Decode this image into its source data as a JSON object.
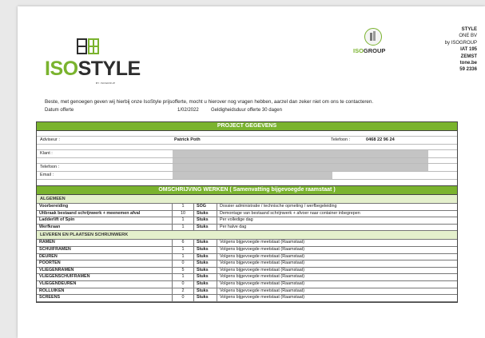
{
  "logo": {
    "brand_iso": "ISO",
    "brand_style": "STYLE",
    "tagline": "BY ISOGROUP"
  },
  "partner_logo": {
    "iso": "ISO",
    "group": "GROUP"
  },
  "company": [
    "STYLE",
    "ONE BV",
    "by ISOGROUP",
    "IAT 195",
    "ZEMST",
    "tone.be",
    "59 2336"
  ],
  "intro": "Beste, met genoegen geven wij hierbij onze IsoStyle prijsofferte, mocht u hierover nog vragen hebben, aarzel dan zeker niet om ons te contacteren.",
  "meta": {
    "date_label": "Datum offerte",
    "date_value": "1/02/2022",
    "validity": "Geldigheidsduur offerte 30 dagen"
  },
  "project": {
    "title": "PROJECT GEGEVENS",
    "adviseur_label": "Adviseur :",
    "adviseur_value": "Patrick Poth",
    "telefoon_label": "Telefoon :",
    "telefoon_value": "0468 22 96 24",
    "klant_label": "Klant :",
    "phone_label": "Telefoon :",
    "email_label": "Email :"
  },
  "works": {
    "title": "OMSCHRIJVING WERKEN ( Samenvatting bijgevoegde raamstaat )",
    "sections": [
      {
        "name": "ALGEMEEN",
        "rows": [
          [
            "Voorbereiding",
            "1",
            "SOG",
            "Dossier administratie / technische opmeting / werfbegeleiding"
          ],
          [
            "Uitbraak bestaand schrijnwerk + meenemen afval",
            "10",
            "Stuks",
            "Demontage van bestaand schrijnwerk + afvoer naar container inbegrepen"
          ],
          [
            "Ladderlift of Spin",
            "1",
            "Stuks",
            "Per volledige dag"
          ],
          [
            "Werfkraan",
            "1",
            "Stuks",
            "Per halve dag"
          ]
        ]
      },
      {
        "name": "LEVEREN EN PLAATSEN SCHRIJNWERK",
        "rows": [
          [
            "RAMEN",
            "6",
            "Stuks",
            "Volgens bijgevoegde meetstaat (Raamstaat)"
          ],
          [
            "SCHUIFRAMEN",
            "1",
            "Stuks",
            "Volgens bijgevoegde meetstaat (Raamstaat)"
          ],
          [
            "DEUREN",
            "1",
            "Stuks",
            "Volgens bijgevoegde meetstaat (Raamstaat)"
          ],
          [
            "POORTEN",
            "0",
            "Stuks",
            "Volgens bijgevoegde meetstaat (Raamstaat)"
          ],
          [
            "VLIEGENRAMEN",
            "5",
            "Stuks",
            "Volgens bijgevoegde meetstaat (Raamstaat)"
          ],
          [
            "VLIEGENSCHUIFRAMEN",
            "1",
            "Stuks",
            "Volgens bijgevoegde meetstaat (Raamstaat)"
          ],
          [
            "VLIEGENDEUREN",
            "0",
            "Stuks",
            "Volgens bijgevoegde meetstaat (Raamstaat)"
          ],
          [
            "ROLLUIKEN",
            "2",
            "Stuks",
            "Volgens bijgevoegde meetstaat (Raamstaat)"
          ],
          [
            "SCREENS",
            "0",
            "Stuks",
            "Volgens bijgevoegde meetstaat (Raamstaat)"
          ]
        ]
      }
    ]
  }
}
